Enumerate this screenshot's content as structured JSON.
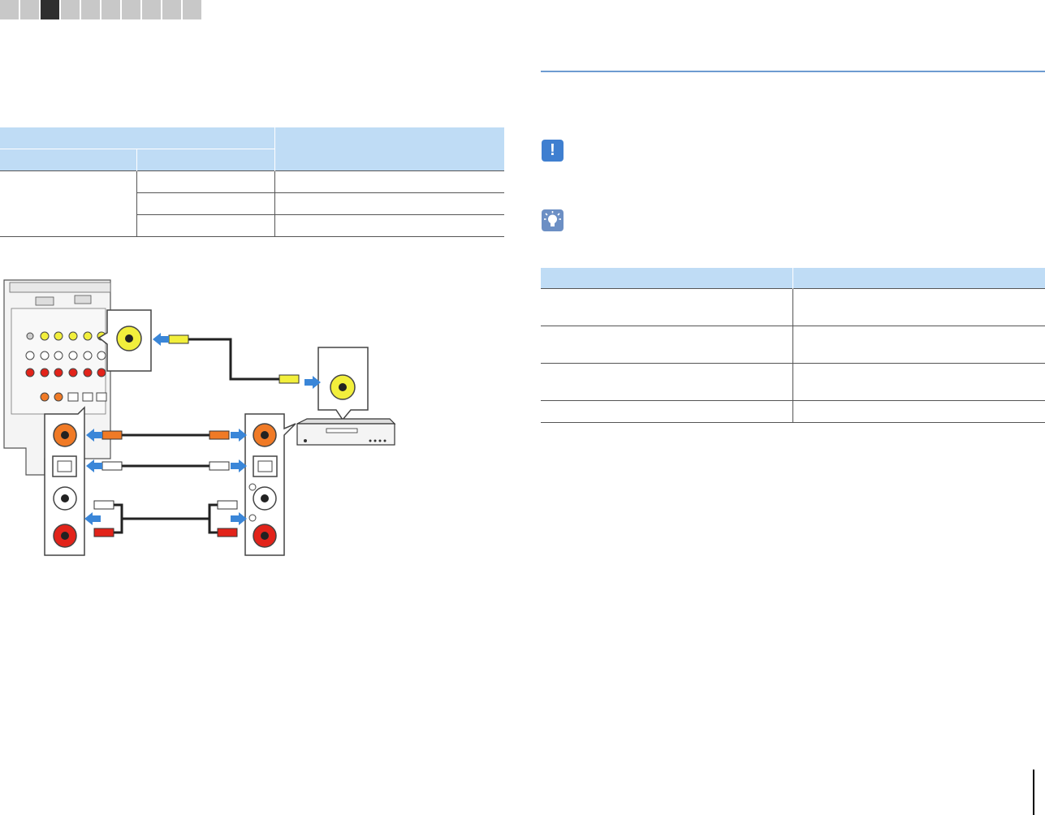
{
  "nav": {
    "tab_count": 10,
    "active_index": 2
  },
  "left_table": {
    "header": [],
    "rows": []
  },
  "right_table": {
    "header": [],
    "rows": []
  },
  "colors": {
    "table_header": "#bfdcf5",
    "rule": "#6d9bd1",
    "caution": "#3f7fd0",
    "hint": "#6c8fc4",
    "nav_active": "#2f2f2f",
    "nav_inactive": "#c8c8c8",
    "cable_video": "#f2ef3c",
    "cable_coaxial": "#f07a26",
    "arrow": "#3a86d8",
    "audio_red": "#e2231a"
  },
  "icons": [
    "caution-icon",
    "hint-icon"
  ]
}
